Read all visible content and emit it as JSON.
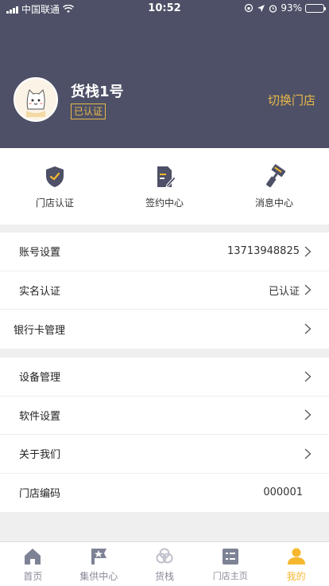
{
  "status_bar": {
    "carrier": "中国联通",
    "time": "10:52",
    "battery": "93%",
    "battery_level": 0.93
  },
  "profile": {
    "store_name": "货栈1号",
    "verified_badge": "已认证",
    "switch_store": "切换门店"
  },
  "shortcuts": [
    {
      "label": "门店认证",
      "icon": "shield-check-icon"
    },
    {
      "label": "签约中心",
      "icon": "document-pen-icon"
    },
    {
      "label": "消息中心",
      "icon": "roller-brush-icon"
    }
  ],
  "settings_group_1": [
    {
      "label": "账号设置",
      "value": "13713948825"
    },
    {
      "label": "实名认证",
      "value": "已认证"
    },
    {
      "label": "银行卡管理",
      "value": ""
    }
  ],
  "settings_group_2": [
    {
      "label": "设备管理",
      "value": ""
    },
    {
      "label": "软件设置",
      "value": ""
    },
    {
      "label": "关于我们",
      "value": ""
    },
    {
      "label": "门店编码",
      "value": "000001"
    }
  ],
  "tabbar": [
    {
      "label": "首页",
      "icon": "home-icon",
      "active": false
    },
    {
      "label": "集供中心",
      "icon": "star-flag-icon",
      "active": false
    },
    {
      "label": "货栈",
      "icon": "chain-icon",
      "active": false
    },
    {
      "label": "门店主页",
      "icon": "store-card-icon",
      "active": false
    },
    {
      "label": "我的",
      "icon": "person-icon",
      "active": true
    }
  ],
  "colors": {
    "header_bg": "#4d5066",
    "accent": "#e8b84a",
    "tab_active": "#f5b72e",
    "icon_dark": "#4d5066"
  }
}
